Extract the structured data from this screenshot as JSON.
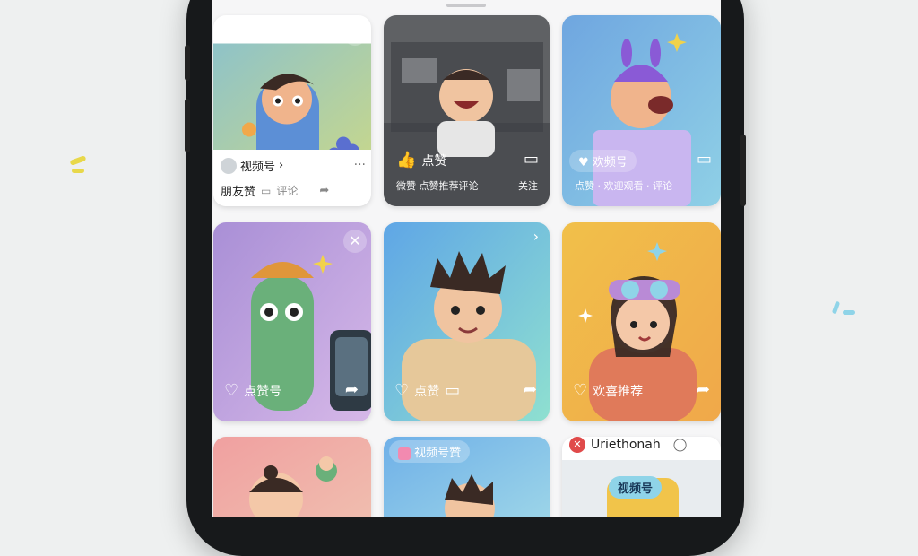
{
  "colors": {
    "background": "#eef0f0",
    "phone_frame": "#17191b",
    "accent_yellow": "#e8d84a",
    "accent_blue": "#8fd4e8"
  },
  "cards": {
    "c1": {
      "close_icon": "close-icon",
      "channel_label": "视频号",
      "more_icon": "more-icon",
      "friend_label": "朋友赞",
      "comment_label": "评论"
    },
    "c2": {
      "like_label": "点赞",
      "caption": "微赞 点赞推荐评论",
      "follow_label": "关注"
    },
    "c3": {
      "like_label": "欢频号",
      "caption": "点赞 · 欢迎观看 · 评论",
      "comment_label": "评论"
    },
    "c4": {
      "close_icon": "close-icon",
      "like_label": "点赞号"
    },
    "c5": {
      "like_label": "点赞"
    },
    "c6": {
      "like_label": "欢喜推荐"
    },
    "c8": {
      "tag_label": "视频号赞"
    },
    "c9": {
      "title": "Uriethonah",
      "badge": "视频号"
    }
  }
}
